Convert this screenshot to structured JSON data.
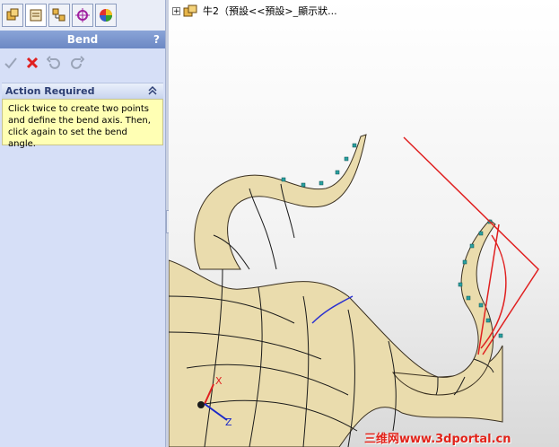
{
  "property_manager": {
    "tabs": [
      {
        "name": "feature-manager-tab",
        "icon": "feature-tree-icon"
      },
      {
        "name": "property-manager-tab",
        "icon": "property-manager-icon"
      },
      {
        "name": "configuration-manager-tab",
        "icon": "configuration-icon"
      },
      {
        "name": "dimxpert-tab",
        "icon": "crosshair-target-icon"
      },
      {
        "name": "display-manager-tab",
        "icon": "color-wheel-icon"
      }
    ],
    "title": "Bend",
    "help": "?",
    "toolbar": [
      "ok-check-icon",
      "cancel-x-icon",
      "undo-icon",
      "redo-icon"
    ],
    "section_title": "Action Required",
    "message": "Click twice to create two points and define the bend axis.  Then, click again to set the bend angle."
  },
  "graphics": {
    "tree_item": "牛2（預設<<預設>_顯示狀...",
    "watermark": "三维网www.3dportal.cn",
    "colors": {
      "model": "#eadcad",
      "edges": "#000000",
      "bend_lines": "#e02020",
      "points": "#2aa0a0",
      "triad_x": "#ff0000",
      "triad_z": "#1a28c8"
    }
  }
}
